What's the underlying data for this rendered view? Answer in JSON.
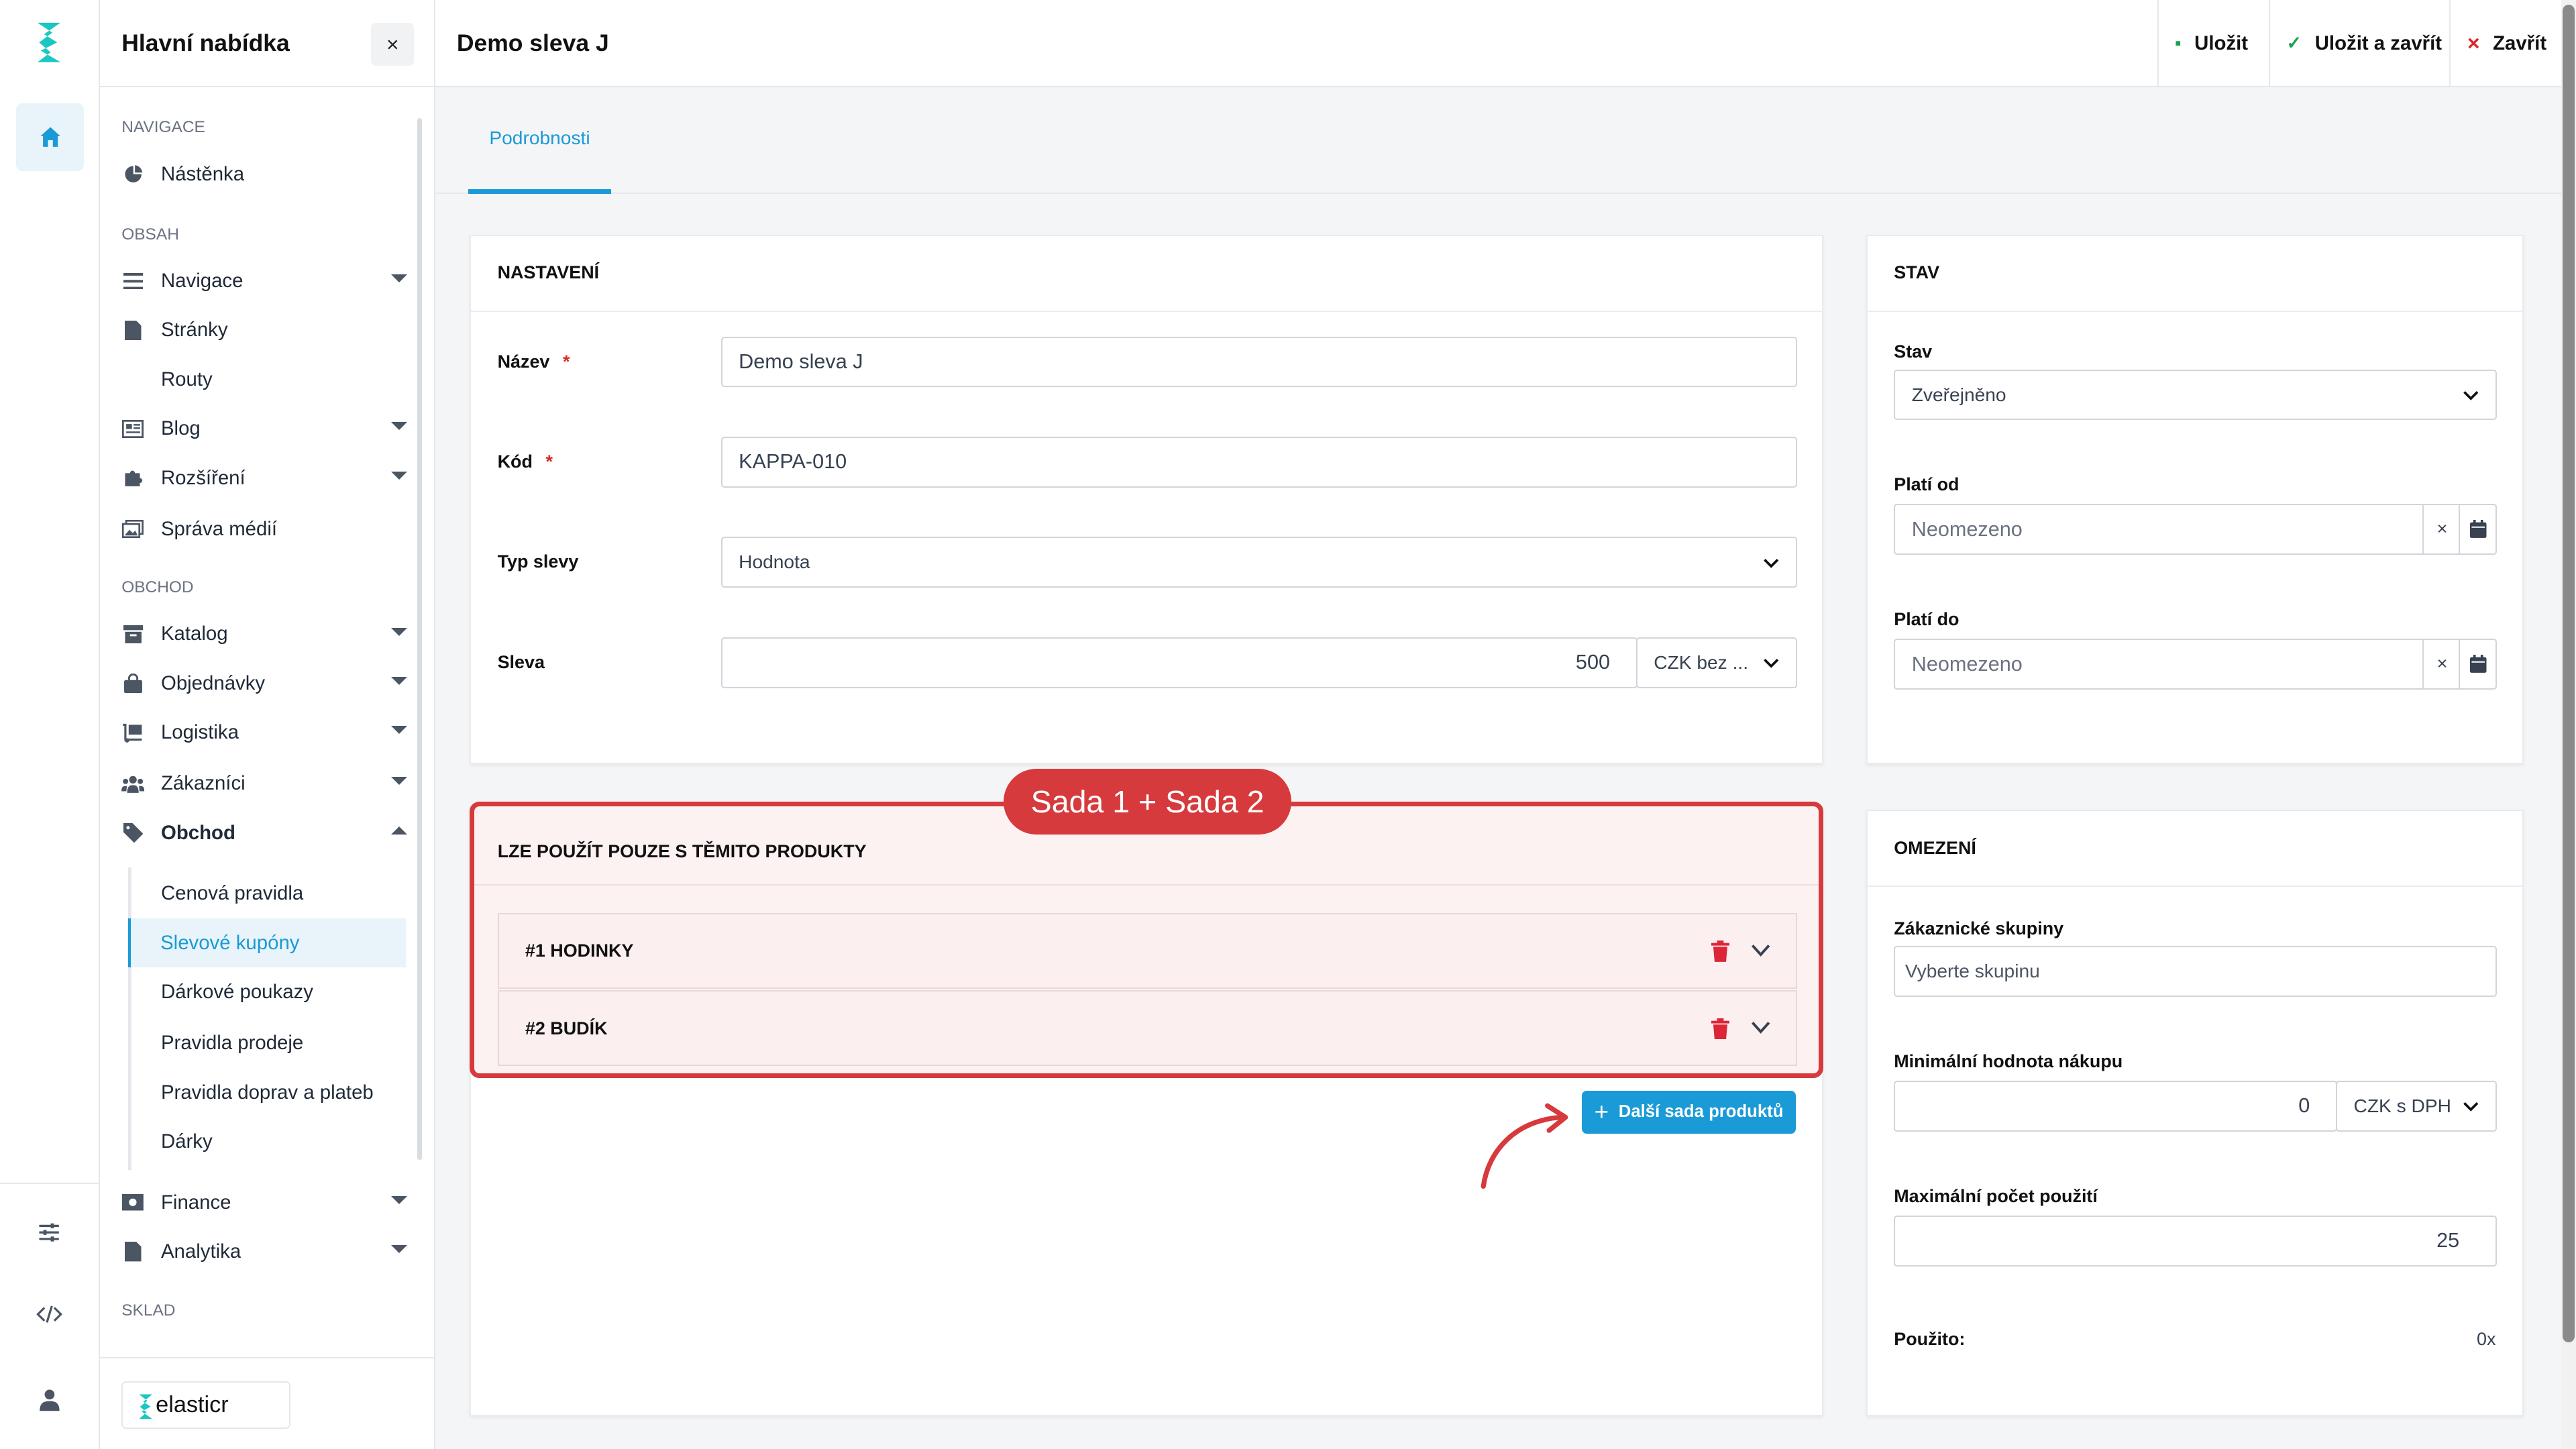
{
  "app": {
    "brand": "elasticr",
    "colors": {
      "accent": "#1a9ad6",
      "highlight": "#d63a3d",
      "brand_teal": "#1cc6c2"
    }
  },
  "menu": {
    "title": "Hlavní nabídka",
    "close_icon": "×",
    "sections": {
      "navigace": "NAVIGACE",
      "obsah": "OBSAH",
      "obchod": "OBCHOD",
      "sklad": "SKLAD"
    },
    "items": {
      "nastenka": "Nástěnka",
      "navigace": "Navigace",
      "stranky": "Stránky",
      "routy": "Routy",
      "blog": "Blog",
      "rozsireni": "Rozšíření",
      "sprava_medii": "Správa médií",
      "katalog": "Katalog",
      "objednavky": "Objednávky",
      "logistika": "Logistika",
      "zakaznici": "Zákazníci",
      "obchod": "Obchod",
      "finance": "Finance",
      "analytika": "Analytika"
    },
    "obchod_sub": {
      "cenova_pravidla": "Cenová pravidla",
      "slevove_kupony": "Slevové kupóny",
      "darkove_poukazy": "Dárkové poukazy",
      "pravidla_prodeje": "Pravidla prodeje",
      "pravidla_doprav": "Pravidla doprav a plateb",
      "darky": "Dárky"
    },
    "footer_brand": "elasticr"
  },
  "topbar": {
    "title": "Demo sleva J",
    "save": "Uložit",
    "save_close": "Uložit a zavřít",
    "close": "Zavřít",
    "save_icon": "▪",
    "check_icon": "✓",
    "x_icon": "×"
  },
  "tabs": {
    "details": "Podrobnosti"
  },
  "nastaveni": {
    "header": "NASTAVENÍ",
    "nazev_label": "Název",
    "nazev_value": "Demo sleva J",
    "kod_label": "Kód",
    "kod_value": "KAPPA-010",
    "typ_label": "Typ slevy",
    "typ_value": "Hodnota",
    "sleva_label": "Sleva",
    "sleva_value": "500",
    "sleva_currency": "CZK bez ...",
    "required_mark": "*"
  },
  "stav": {
    "header": "STAV",
    "stav_label": "Stav",
    "stav_value": "Zveřejněno",
    "plati_od_label": "Platí od",
    "plati_od_value": "Neomezeno",
    "plati_do_label": "Platí do",
    "plati_do_value": "Neomezeno",
    "clear_icon": "×"
  },
  "products": {
    "header": "LZE POUŽÍT POUZE S TĚMITO PRODUKTY",
    "badge": "Sada 1 + Sada 2",
    "rows": [
      "#1 HODINKY",
      "#2 BUDÍK"
    ],
    "add_button": "Další sada produktů",
    "add_icon": "+"
  },
  "omezeni": {
    "header": "OMEZENÍ",
    "skupiny_label": "Zákaznické skupiny",
    "skupiny_placeholder": "Vyberte skupinu",
    "min_label": "Minimální hodnota nákupu",
    "min_value": "0",
    "min_currency": "CZK s DPH",
    "max_label": "Maximální počet použití",
    "max_value": "25",
    "pouzito_label": "Použito:",
    "pouzito_value": "0x"
  }
}
